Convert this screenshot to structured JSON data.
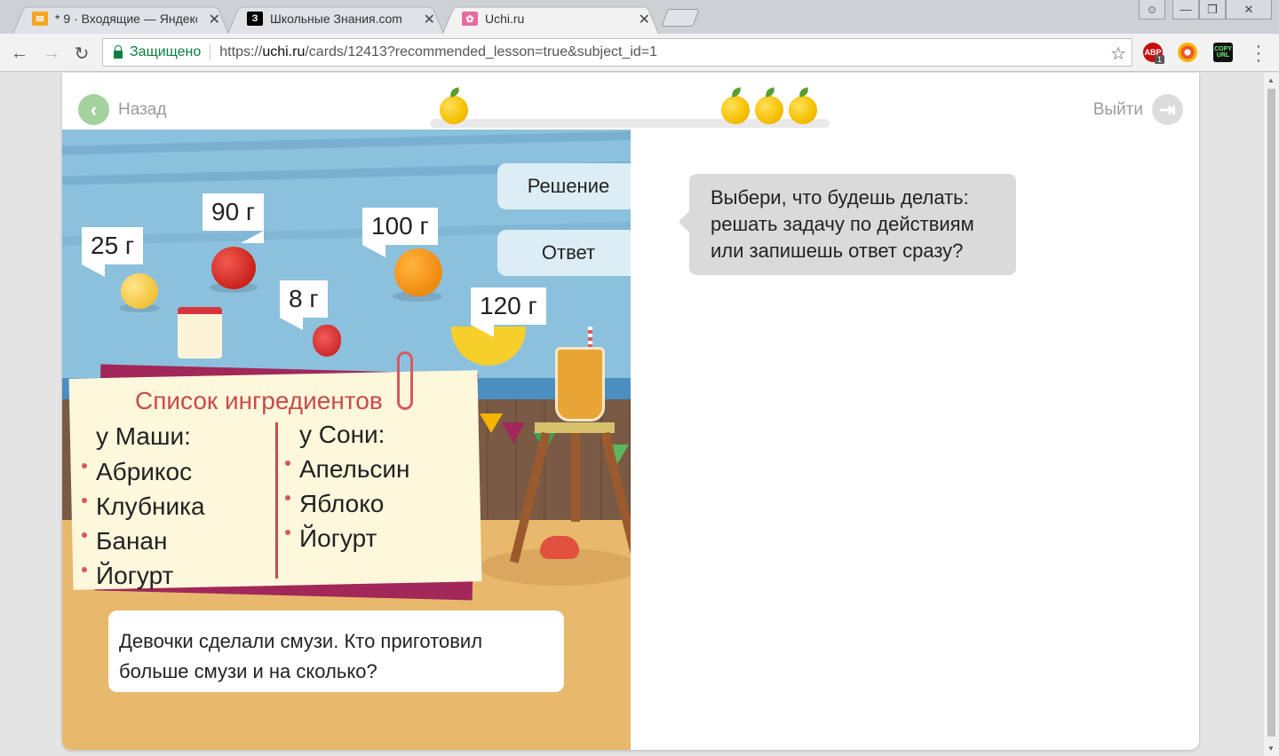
{
  "browser": {
    "tabs": [
      {
        "label": "* 9 · Входящие — Яндекс",
        "favicon": "mail-icon",
        "color": "#f5a623"
      },
      {
        "label": "Школьные Знания.com",
        "favicon": "znanija-icon",
        "color": "#000000"
      },
      {
        "label": "Uchi.ru",
        "favicon": "uchi-icon",
        "color": "#ffffff"
      }
    ],
    "secure_label": "Защищено",
    "url_prefix": "https://",
    "url_host": "uchi.ru",
    "url_path": "/cards/12413?recommended_lesson=true&subject_id=1",
    "extensions": [
      {
        "label": "ABP",
        "badge": "1",
        "color": "#c70d0d"
      },
      {
        "label": "",
        "color": "#e8562b"
      },
      {
        "label": "COPY URL",
        "color": "#111111"
      }
    ]
  },
  "page": {
    "back_label": "Назад",
    "exit_label": "Выйти",
    "progress": {
      "total_oranges": 4
    }
  },
  "scene": {
    "prices": {
      "apricot": "25 г",
      "apple": "90 г",
      "orange": "100 г",
      "strawberry": "8 г",
      "banana": "120 г"
    },
    "choices": {
      "solution": "Решение",
      "answer": "Ответ"
    },
    "list": {
      "title": "Список ингредиентов",
      "masha_head": "у Маши:",
      "masha": [
        "Абрикос",
        "Клубника",
        "Банан",
        "Йогурт"
      ],
      "sonya_head": "у Сони:",
      "sonya": [
        "Апельсин",
        "Яблоко",
        "Йогурт"
      ]
    },
    "task_line1": "Девочки сделали смузи. Кто приготовил",
    "task_line2": "больше смузи и на сколько?"
  },
  "hint": {
    "line1": "Выбери, что будешь делать:",
    "line2": "решать задачу по действиям",
    "line3": "или запишешь ответ сразу?"
  }
}
